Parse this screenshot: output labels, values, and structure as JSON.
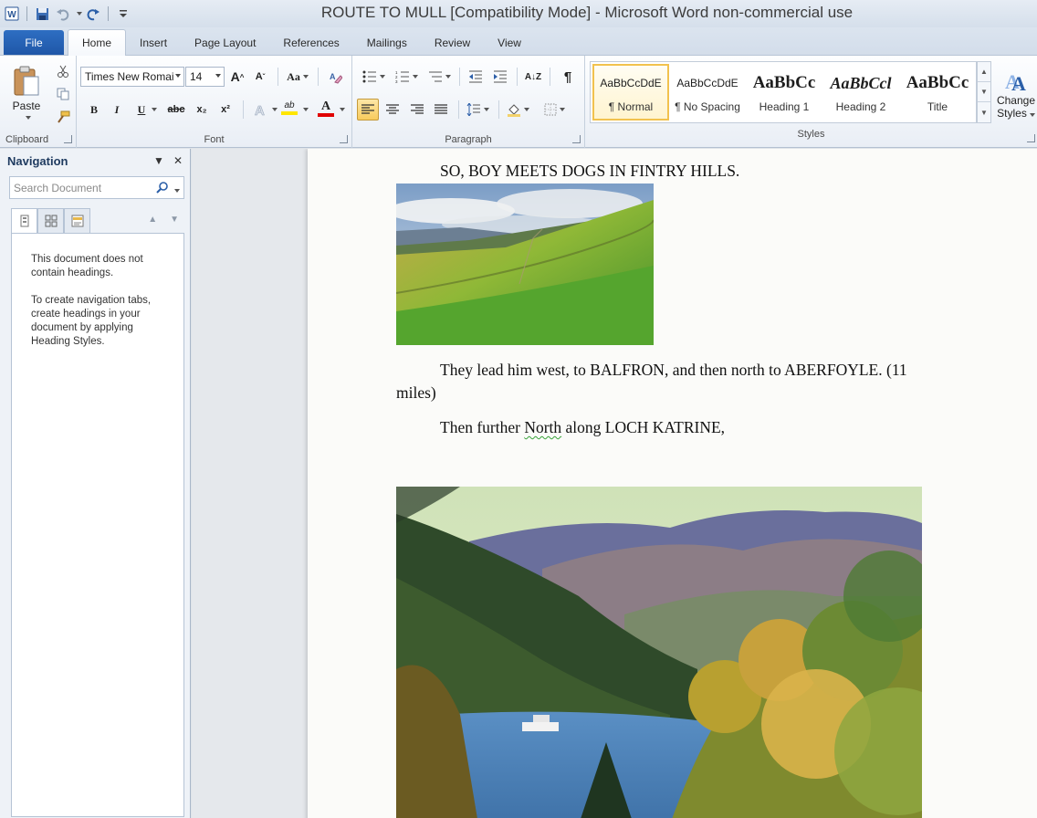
{
  "window": {
    "title": "ROUTE TO MULL [Compatibility Mode]  -  Microsoft Word non-commercial use"
  },
  "tabs": [
    {
      "label": "File"
    },
    {
      "label": "Home"
    },
    {
      "label": "Insert"
    },
    {
      "label": "Page Layout"
    },
    {
      "label": "References"
    },
    {
      "label": "Mailings"
    },
    {
      "label": "Review"
    },
    {
      "label": "View"
    }
  ],
  "ribbon": {
    "clipboard": {
      "paste": "Paste",
      "label": "Clipboard"
    },
    "font": {
      "name": "Times New Romai",
      "size": "14",
      "label": "Font",
      "grow": "A",
      "shrink": "A",
      "case": "Aa",
      "bold": "B",
      "italic": "I",
      "underline": "U",
      "strike": "abc",
      "subscript": "x₂",
      "superscript": "x²",
      "highlight": "ab",
      "fontcolor": "A"
    },
    "paragraph": {
      "label": "Paragraph",
      "pilcrow": "¶",
      "sort": "A↓Z"
    },
    "styles": {
      "label": "Styles",
      "items": [
        {
          "sample": "AaBbCcDdE",
          "name": "¶ Normal"
        },
        {
          "sample": "AaBbCcDdE",
          "name": "¶ No Spacing"
        },
        {
          "sample": "AaBbCc",
          "name": "Heading 1"
        },
        {
          "sample": "AaBbCcl",
          "name": "Heading 2"
        },
        {
          "sample": "AaBbCc",
          "name": "Title"
        }
      ],
      "change_styles_line1": "Change",
      "change_styles_line2": "Styles"
    }
  },
  "navigation": {
    "title": "Navigation",
    "search_placeholder": "Search Document",
    "message1": "This document does not contain headings.",
    "message2": "To create navigation tabs, create headings in your document by applying Heading Styles."
  },
  "document": {
    "line1": "SO, BOY MEETS DOGS IN FINTRY HILLS.",
    "line2a": "They lead him west, to BALFRON, and then north to ABERFOYLE. (11",
    "line2b": "miles)",
    "line3_pre": "Then further ",
    "line3_word": "North",
    "line3_post": " along LOCH KATRINE,"
  },
  "colors": {
    "file_tab": "#2a66b8",
    "selection_gold": "#f2c24e",
    "squiggle": "#3aa33a"
  }
}
